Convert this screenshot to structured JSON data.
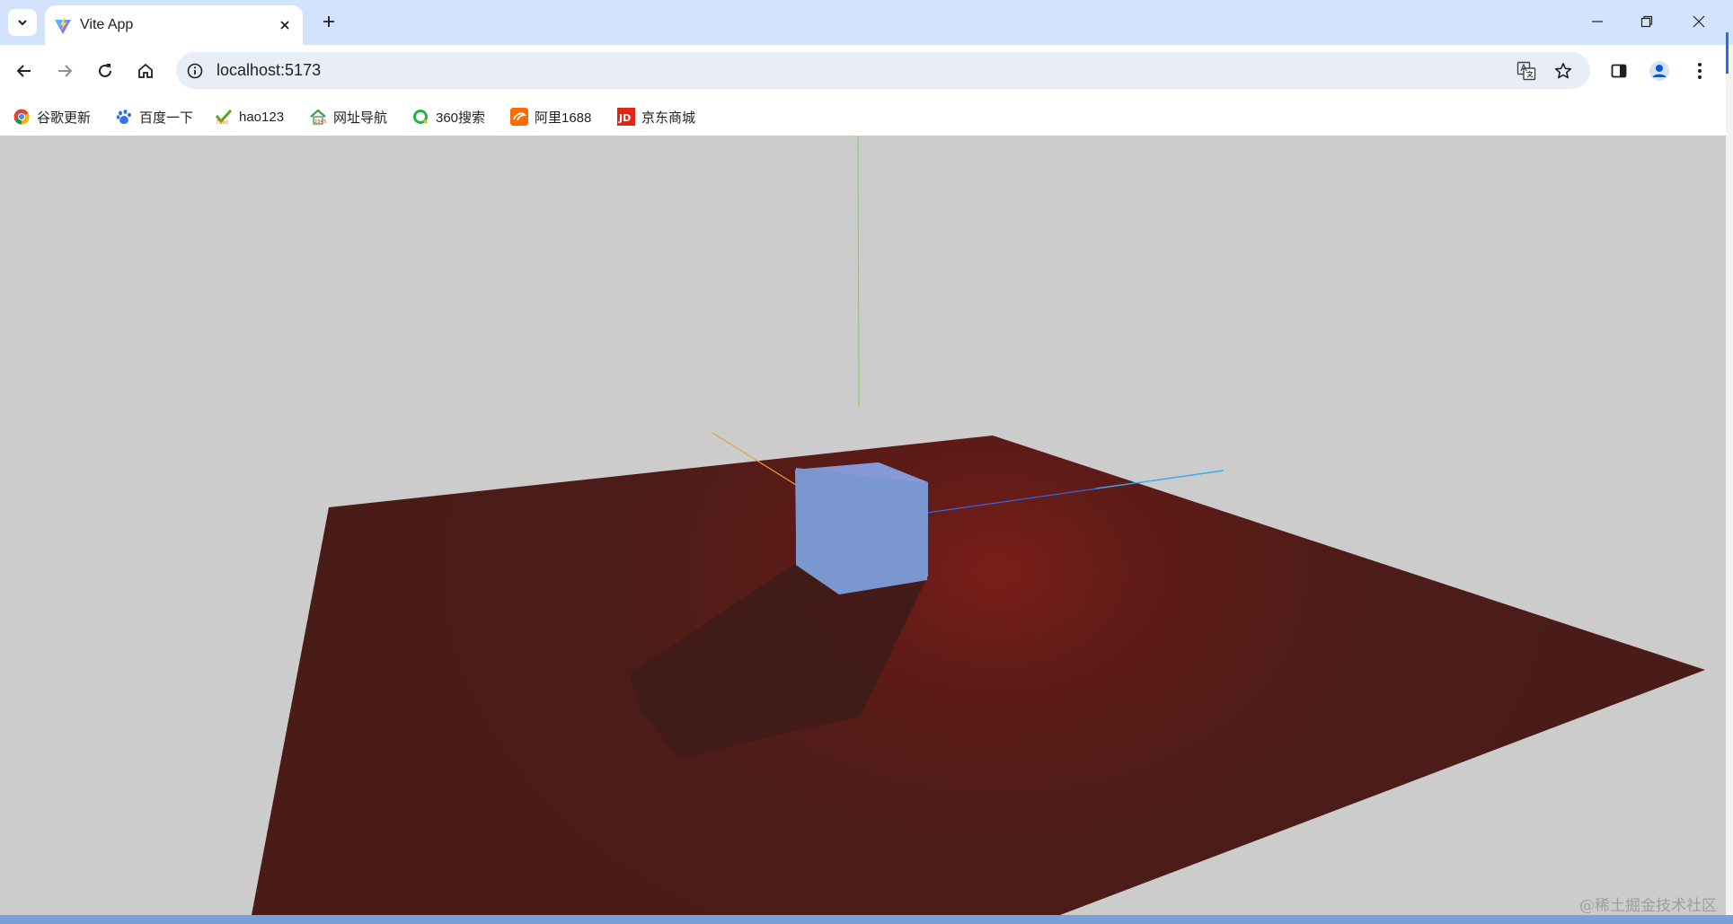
{
  "tab": {
    "title": "Vite App",
    "favicon": "vite-logo-icon"
  },
  "address_bar": {
    "url": "localhost:5173"
  },
  "bookmarks": [
    {
      "label": "谷歌更新",
      "icon": "chrome-icon"
    },
    {
      "label": "百度一下",
      "icon": "baidu-paw-icon"
    },
    {
      "label": "hao123",
      "icon": "hao123-icon"
    },
    {
      "label": "网址导航",
      "icon": "house-nav-icon"
    },
    {
      "label": "360搜索",
      "icon": "360-search-icon"
    },
    {
      "label": "阿里1688",
      "icon": "alibaba-icon"
    },
    {
      "label": "京东商城",
      "icon": "jd-icon"
    }
  ],
  "scene": {
    "background": "#cccccc",
    "floor_color": "#4a1c18",
    "spotlight_color": "#7a1e18",
    "cube_color": "#7b97cf",
    "axis_x_color": "#2f6bf0",
    "axis_y_color": "#7ed957",
    "axis_z_color": "#e7a23a"
  },
  "watermark": "@稀土掘金技术社区",
  "colors": {
    "tabstrip": "#d3e3fd",
    "omnibox": "#e9eef6",
    "accent": "#1a73e8"
  }
}
